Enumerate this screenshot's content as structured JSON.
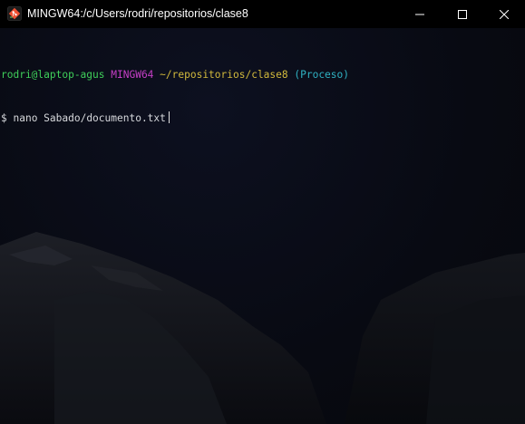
{
  "window": {
    "title": "MINGW64:/c/Users/rodri/repositorios/clase8",
    "app_icon": "git-bash-icon",
    "buttons": {
      "minimize_icon": "minimize-icon",
      "maximize_icon": "maximize-icon",
      "close_icon": "close-icon"
    }
  },
  "terminal": {
    "prompt": {
      "user_host": "rodri@laptop-agus",
      "system": "MINGW64",
      "path": "~/repositorios/clase8",
      "branch": "(Proceso)"
    },
    "command_line": {
      "symbol": "$",
      "command": "nano Sabado/documento.txt"
    }
  },
  "colors": {
    "titlebar": "#000000",
    "user_host": "#3fcf5a",
    "system": "#c63fc7",
    "path": "#d2b93c",
    "branch": "#2fb2c3",
    "text": "#cfd3d8"
  }
}
